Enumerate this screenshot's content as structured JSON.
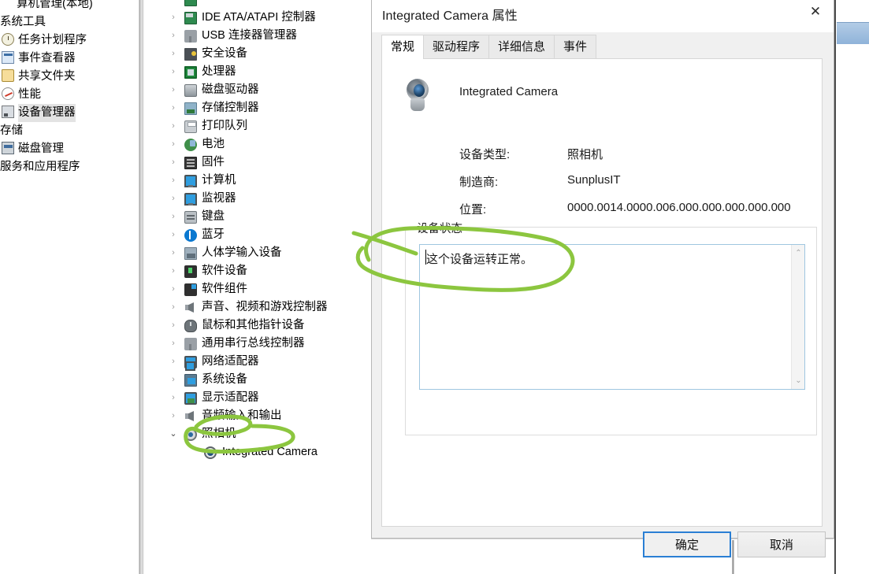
{
  "console_tree": {
    "items": [
      {
        "label": "算机管理(本地)",
        "icon": "computer-management-icon",
        "indent": 0,
        "clipped": true,
        "selected": false
      },
      {
        "label": "系统工具",
        "icon": "none",
        "indent": 0,
        "selected": false
      },
      {
        "label": "任务计划程序",
        "icon": "clock-icon",
        "indent": 1,
        "selected": false
      },
      {
        "label": "事件查看器",
        "icon": "event-viewer-icon",
        "indent": 1,
        "selected": false
      },
      {
        "label": "共享文件夹",
        "icon": "shared-folder-icon",
        "indent": 1,
        "selected": false
      },
      {
        "label": "性能",
        "icon": "performance-icon",
        "indent": 1,
        "selected": false
      },
      {
        "label": "设备管理器",
        "icon": "device-manager-icon",
        "indent": 1,
        "selected": true
      },
      {
        "label": "存储",
        "icon": "none",
        "indent": 0,
        "clipped": true,
        "selected": false
      },
      {
        "label": "磁盘管理",
        "icon": "disk-management-icon",
        "indent": 1,
        "selected": false
      },
      {
        "label": "服务和应用程序",
        "icon": "none",
        "indent": 0,
        "clipped": true,
        "selected": false
      }
    ]
  },
  "device_tree": {
    "items": [
      {
        "label": "",
        "icon": "cut-off-icon",
        "expandable": false,
        "expanded": false,
        "child": false,
        "clipped": true
      },
      {
        "label": "IDE ATA/ATAPI 控制器",
        "icon": "ide-controller-icon",
        "expandable": true,
        "expanded": false,
        "child": false
      },
      {
        "label": "USB 连接器管理器",
        "icon": "usb-icon",
        "expandable": true,
        "expanded": false,
        "child": false
      },
      {
        "label": "安全设备",
        "icon": "security-device-icon",
        "expandable": true,
        "expanded": false,
        "child": false
      },
      {
        "label": "处理器",
        "icon": "processor-icon",
        "expandable": true,
        "expanded": false,
        "child": false
      },
      {
        "label": "磁盘驱动器",
        "icon": "disk-drive-icon",
        "expandable": true,
        "expanded": false,
        "child": false
      },
      {
        "label": "存储控制器",
        "icon": "storage-controller-icon",
        "expandable": true,
        "expanded": false,
        "child": false
      },
      {
        "label": "打印队列",
        "icon": "print-queue-icon",
        "expandable": true,
        "expanded": false,
        "child": false
      },
      {
        "label": "电池",
        "icon": "battery-icon",
        "expandable": true,
        "expanded": false,
        "child": false
      },
      {
        "label": "固件",
        "icon": "firmware-icon",
        "expandable": true,
        "expanded": false,
        "child": false
      },
      {
        "label": "计算机",
        "icon": "computer-icon",
        "expandable": true,
        "expanded": false,
        "child": false
      },
      {
        "label": "监视器",
        "icon": "monitor-icon",
        "expandable": true,
        "expanded": false,
        "child": false
      },
      {
        "label": "键盘",
        "icon": "keyboard-icon",
        "expandable": true,
        "expanded": false,
        "child": false
      },
      {
        "label": "蓝牙",
        "icon": "bluetooth-icon",
        "expandable": true,
        "expanded": false,
        "child": false
      },
      {
        "label": "人体学输入设备",
        "icon": "hid-icon",
        "expandable": true,
        "expanded": false,
        "child": false
      },
      {
        "label": "软件设备",
        "icon": "software-device-icon",
        "expandable": true,
        "expanded": false,
        "child": false
      },
      {
        "label": "软件组件",
        "icon": "software-component-icon",
        "expandable": true,
        "expanded": false,
        "child": false
      },
      {
        "label": "声音、视频和游戏控制器",
        "icon": "sound-video-game-icon",
        "expandable": true,
        "expanded": false,
        "child": false
      },
      {
        "label": "鼠标和其他指针设备",
        "icon": "mouse-icon",
        "expandable": true,
        "expanded": false,
        "child": false
      },
      {
        "label": "通用串行总线控制器",
        "icon": "usb-controller-icon",
        "expandable": true,
        "expanded": false,
        "child": false
      },
      {
        "label": "网络适配器",
        "icon": "network-adapter-icon",
        "expandable": true,
        "expanded": false,
        "child": false
      },
      {
        "label": "系统设备",
        "icon": "system-device-icon",
        "expandable": true,
        "expanded": false,
        "child": false
      },
      {
        "label": "显示适配器",
        "icon": "display-adapter-icon",
        "expandable": true,
        "expanded": false,
        "child": false
      },
      {
        "label": "音频输入和输出",
        "icon": "audio-io-icon",
        "expandable": true,
        "expanded": false,
        "child": false
      },
      {
        "label": "照相机",
        "icon": "camera-category-icon",
        "expandable": true,
        "expanded": true,
        "child": false
      },
      {
        "label": "Integrated Camera",
        "icon": "camera-device-icon",
        "expandable": false,
        "expanded": false,
        "child": true
      }
    ]
  },
  "dialog": {
    "title": "Integrated Camera 属性",
    "close_icon": "close-icon",
    "tabs": [
      {
        "label": "常规",
        "active": true
      },
      {
        "label": "驱动程序",
        "active": false
      },
      {
        "label": "详细信息",
        "active": false
      },
      {
        "label": "事件",
        "active": false
      }
    ],
    "device_name": "Integrated Camera",
    "device_icon": "webcam-icon",
    "fields": [
      {
        "label": "设备类型:",
        "value": "照相机"
      },
      {
        "label": "制造商:",
        "value": "SunplusIT"
      },
      {
        "label": "位置:",
        "value": "0000.0014.0000.006.000.000.000.000.000"
      }
    ],
    "status_group_label": "设备状态",
    "status_text": "这个设备运转正常。",
    "scrollbar": {
      "up_icon": "chevron-up-icon",
      "down_icon": "chevron-down-icon"
    },
    "buttons": [
      {
        "label": "确定",
        "primary": true
      },
      {
        "label": "取消",
        "primary": false
      }
    ]
  },
  "annotations": {
    "color": "#8CC63F",
    "shapes": [
      {
        "name": "device-status-circle",
        "type": "ellipse"
      },
      {
        "name": "camera-node-circle",
        "type": "ellipse"
      }
    ]
  }
}
